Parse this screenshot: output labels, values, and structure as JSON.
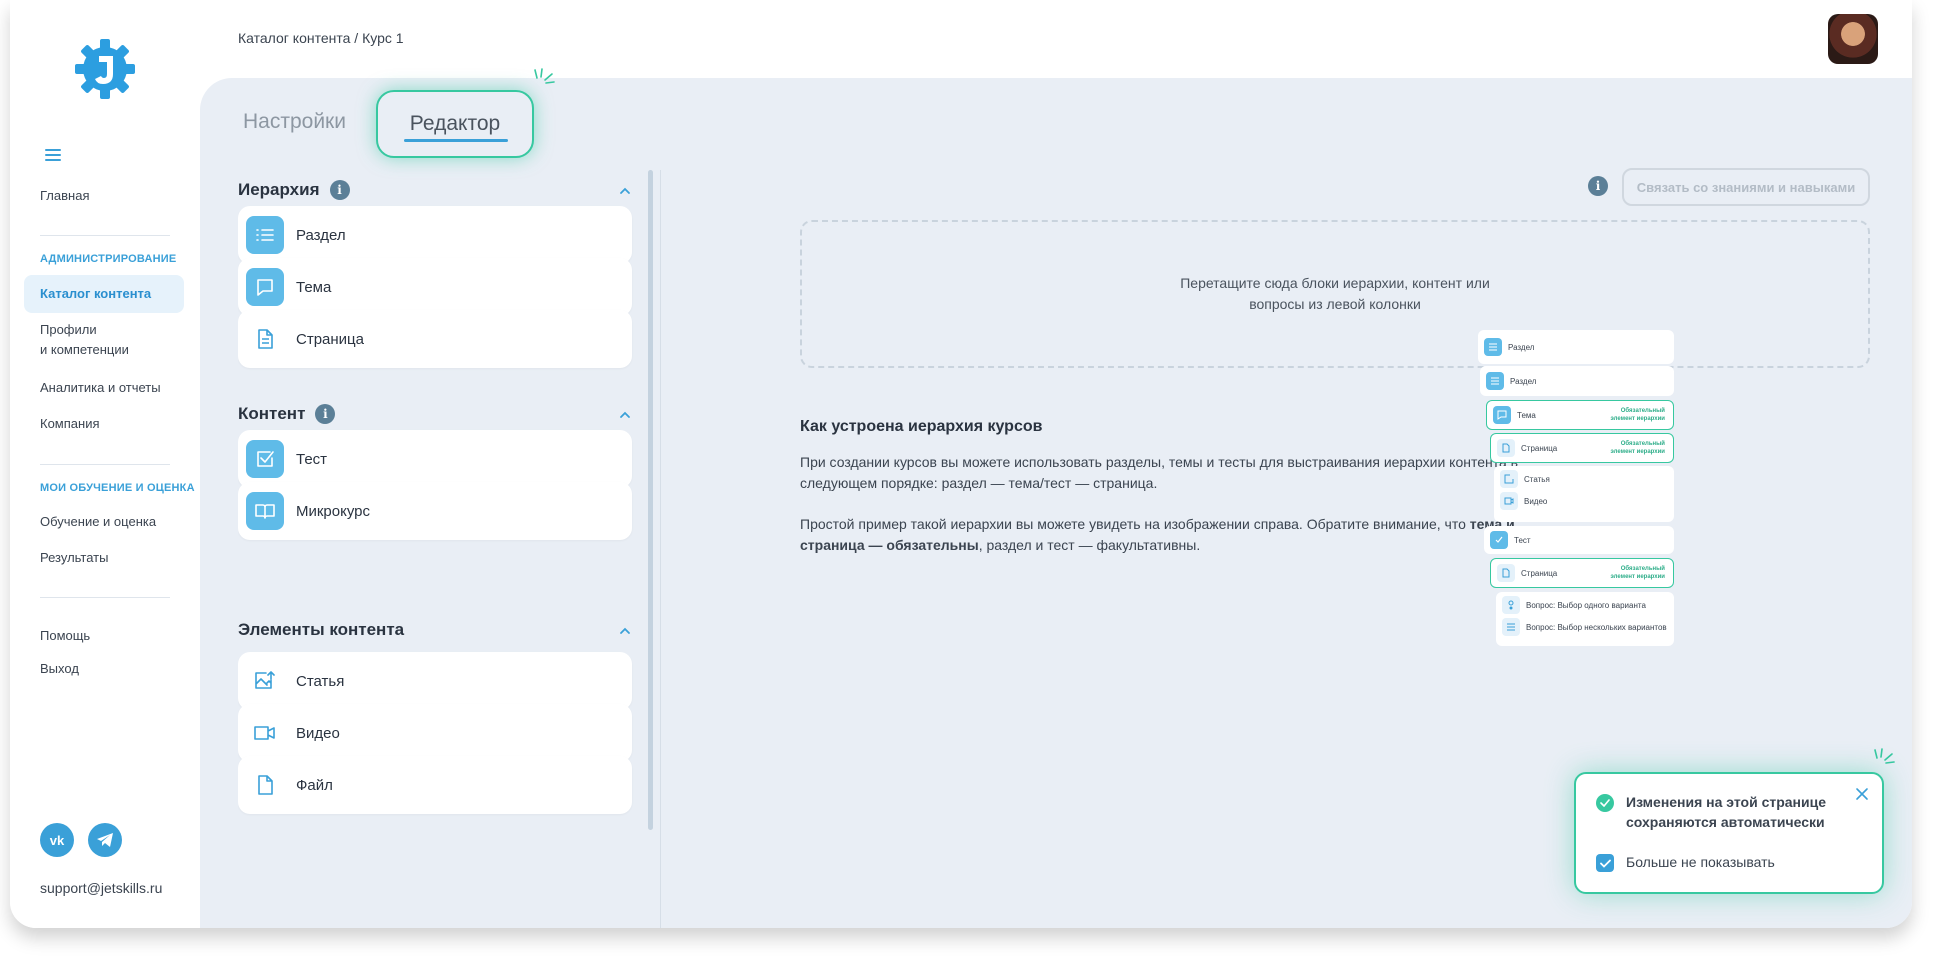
{
  "breadcrumb": "Каталог контента / Курс 1",
  "sidebar": {
    "home": "Главная",
    "section_admin": "АДМИНИСТРИРОВАНИЕ",
    "catalog": "Каталог контента",
    "profiles_l1": "Профили",
    "profiles_l2": "и компетенции",
    "analytics": "Аналитика и отчеты",
    "company": "Компания",
    "section_learning": "МОИ ОБУЧЕНИЕ И ОЦЕНКА",
    "learning": "Обучение и оценка",
    "results": "Результаты",
    "help": "Помощь",
    "logout": "Выход",
    "vk": "vk",
    "support": "support@jetskills.ru"
  },
  "tabs": {
    "settings": "Настройки",
    "editor": "Редактор"
  },
  "hierarchy": {
    "title": "Иерархия",
    "items": [
      "Раздел",
      "Тема",
      "Страница"
    ]
  },
  "content": {
    "title": "Контент",
    "items": [
      "Тест",
      "Микрокурс"
    ]
  },
  "elements": {
    "title": "Элементы контента",
    "items": [
      "Статья",
      "Видео",
      "Файл"
    ]
  },
  "link_button": "Связать со знаниями и навыками",
  "dropzone": {
    "line1": "Перетащите сюда блоки иерархии, контент или",
    "line2": "вопросы из левой колонки"
  },
  "how": {
    "title": "Как устроена иерархия курсов",
    "p1_l1": "При создании курсов вы можете использовать разделы, темы и тесты для выстраивания иерархии контента в",
    "p1_l2": "следующем порядке: раздел — тема/тест — страница.",
    "p2_l1": "Простой пример такой иерархии вы можете увидеть на изображении справа. Обратите внимание, что ",
    "p2_bold1": "тема и",
    "p2_bold2": "страница — обязательны",
    "p2_rest": ", раздел и тест — факультативны."
  },
  "mini": {
    "required_l1": "Обязательный",
    "required_l2": "элемент иерархии",
    "rows": [
      "Раздел",
      "Раздел",
      "Тема",
      "Страница",
      "Статья",
      "Видео",
      "Тест",
      "Страница",
      "Вопрос: Выбор одного варианта",
      "Вопрос: Выбор нескольких вариантов"
    ]
  },
  "toast": {
    "line1": "Изменения на этой странице",
    "line2": "сохраняются автоматически",
    "checkbox": "Больше не показывать"
  },
  "colors": {
    "accent": "#3aa0d8",
    "highlight": "#37c8a0",
    "background": "#e9eef5"
  }
}
